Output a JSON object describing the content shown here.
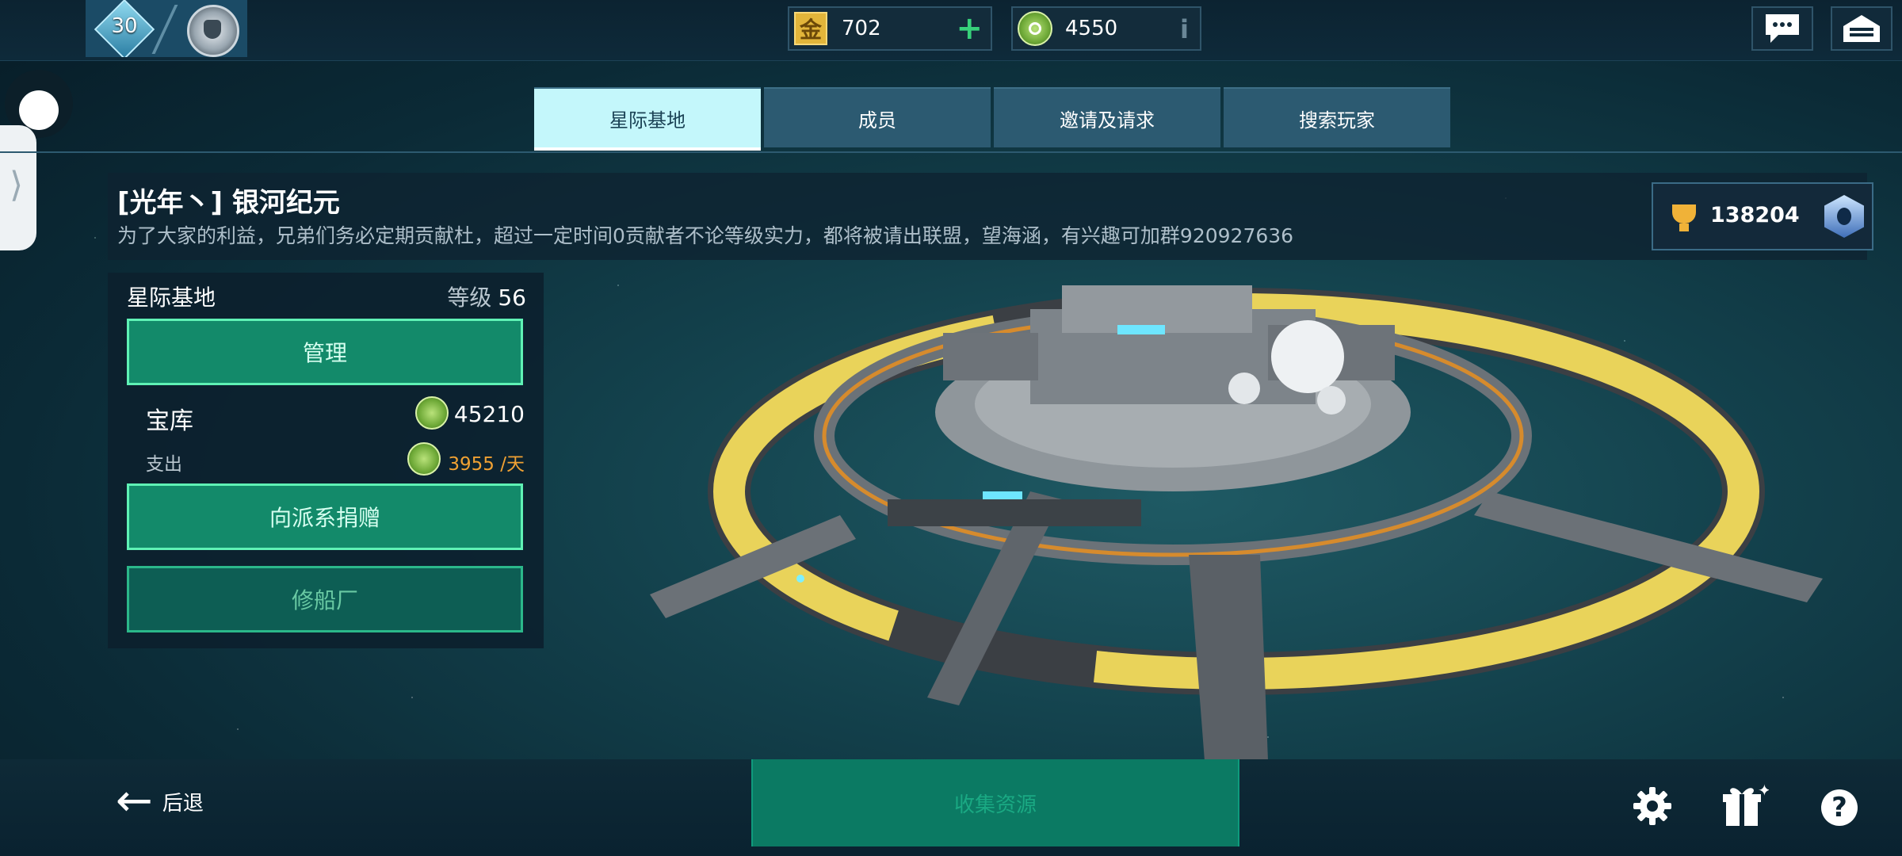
{
  "player": {
    "level": "30"
  },
  "resources": {
    "gold": {
      "icon_char": "金",
      "value": "702"
    },
    "alloy": {
      "value": "4550"
    }
  },
  "tabs": [
    {
      "label": "星际基地",
      "active": true
    },
    {
      "label": "成员",
      "active": false
    },
    {
      "label": "邀请及请求",
      "active": false
    },
    {
      "label": "搜索玩家",
      "active": false
    }
  ],
  "alliance": {
    "name": "[光年丶] 银河纪元",
    "description": "为了大家的利益，兄弟们务必定期贡献杜，超过一定时间0贡献者不论等级实力，都将被请出联盟，望海涵，有兴趣可加群920927636",
    "trophies": "138204"
  },
  "base_panel": {
    "title": "星际基地",
    "level_label": "等级",
    "level_value": "56",
    "manage_label": "管理",
    "vault_label": "宝库",
    "vault_value": "45210",
    "expense_label": "支出",
    "expense_value": "3955 /天",
    "donate_label": "向派系捐赠",
    "shipyard_label": "修船厂"
  },
  "bottom": {
    "back_label": "后退",
    "collect_label": "收集资源"
  },
  "colors": {
    "accent_green": "#138a6a",
    "active_tab": "#c4f7fb",
    "expense_orange": "#f0a133"
  }
}
